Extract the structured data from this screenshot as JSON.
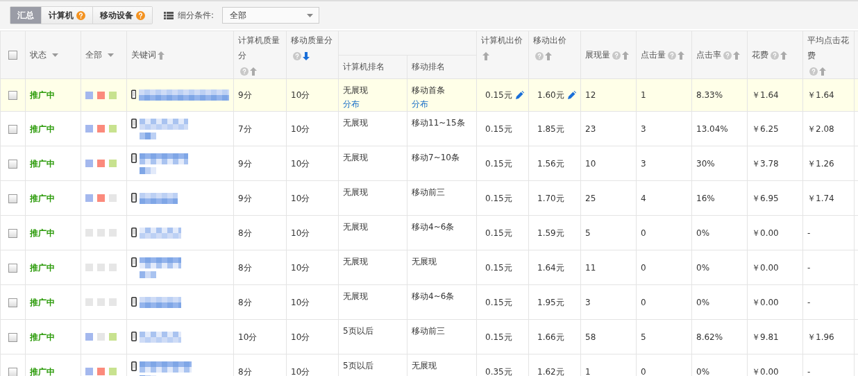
{
  "toolbar": {
    "tabs": [
      {
        "label": "汇总",
        "selected": true,
        "help": false
      },
      {
        "label": "计算机",
        "selected": false,
        "help": true
      },
      {
        "label": "移动设备",
        "selected": false,
        "help": true
      }
    ],
    "filter_label": "细分条件:",
    "filter_value": "全部"
  },
  "table": {
    "select_all": {
      "checked": false
    },
    "columns": [
      {
        "label": "状态",
        "dropdown": true,
        "help": false,
        "sortable": false
      },
      {
        "label": "全部",
        "dropdown": true,
        "help": false,
        "sortable": false
      },
      {
        "label": "关键词",
        "dropdown": false,
        "help": false,
        "sortable": true,
        "active_sort": false
      },
      {
        "label": "计算机质量分",
        "dropdown": false,
        "help": true,
        "sortable": true,
        "active_sort": false
      },
      {
        "label": "移动质量分",
        "dropdown": false,
        "help": true,
        "sortable": true,
        "active_sort": true
      },
      {
        "label": "计算机排名",
        "dropdown": false,
        "help": false,
        "sortable": false
      },
      {
        "label": "移动排名",
        "dropdown": false,
        "help": false,
        "sortable": false
      },
      {
        "label": "计算机出价",
        "dropdown": false,
        "help": false,
        "sortable": true,
        "active_sort": false
      },
      {
        "label": "移动出价",
        "dropdown": false,
        "help": true,
        "sortable": true,
        "active_sort": false
      },
      {
        "label": "展现量",
        "dropdown": false,
        "help": true,
        "sortable": true,
        "active_sort": false
      },
      {
        "label": "点击量",
        "dropdown": false,
        "help": true,
        "sortable": true,
        "active_sort": false
      },
      {
        "label": "点击率",
        "dropdown": false,
        "help": true,
        "sortable": true,
        "active_sort": false
      },
      {
        "label": "花费",
        "dropdown": false,
        "help": true,
        "sortable": true,
        "active_sort": false
      },
      {
        "label": "平均点击花费",
        "dropdown": false,
        "help": true,
        "sortable": true,
        "active_sort": false
      }
    ],
    "rows": [
      {
        "selected": true,
        "checked": false,
        "status": "推广中",
        "flags": [
          {
            "on": true,
            "color": "#a4b8ee"
          },
          {
            "on": true,
            "color": "#fb8a7c"
          },
          {
            "on": true,
            "color": "#c8e28f"
          }
        ],
        "pc_score": "9分",
        "mobile_score": "10分",
        "pc_rank": "无展现",
        "pc_rank_link": "分布",
        "mobile_rank": "移动首条",
        "mobile_rank_link": "分布",
        "pc_bid": "0.15元",
        "mobile_bid": "1.60元",
        "impressions": "12",
        "clicks": "1",
        "ctr": "8.33%",
        "cost": "￥1.64",
        "avg_cpc": "￥1.64"
      },
      {
        "selected": false,
        "checked": false,
        "status": "推广中",
        "flags": [
          {
            "on": true,
            "color": "#a4b8ee"
          },
          {
            "on": true,
            "color": "#fb8a7c"
          },
          {
            "on": true,
            "color": "#c8e28f"
          }
        ],
        "pc_score": "7分",
        "mobile_score": "10分",
        "pc_rank": "无展现",
        "mobile_rank": "移动11~15条",
        "pc_bid": "0.15元",
        "mobile_bid": "1.85元",
        "impressions": "23",
        "clicks": "3",
        "ctr": "13.04%",
        "cost": "￥6.25",
        "avg_cpc": "￥2.08"
      },
      {
        "selected": false,
        "checked": false,
        "status": "推广中",
        "flags": [
          {
            "on": true,
            "color": "#a4b8ee"
          },
          {
            "on": true,
            "color": "#fb8a7c"
          },
          {
            "on": true,
            "color": "#c8e28f"
          }
        ],
        "pc_score": "9分",
        "mobile_score": "10分",
        "pc_rank": "无展现",
        "mobile_rank": "移动7~10条",
        "pc_bid": "0.15元",
        "mobile_bid": "1.56元",
        "impressions": "10",
        "clicks": "3",
        "ctr": "30%",
        "cost": "￥3.78",
        "avg_cpc": "￥1.26"
      },
      {
        "selected": false,
        "checked": false,
        "status": "推广中",
        "flags": [
          {
            "on": true,
            "color": "#a4b8ee"
          },
          {
            "on": true,
            "color": "#fb8a7c"
          },
          {
            "on": false
          }
        ],
        "pc_score": "9分",
        "mobile_score": "10分",
        "pc_rank": "无展现",
        "mobile_rank": "移动前三",
        "pc_bid": "0.15元",
        "mobile_bid": "1.70元",
        "impressions": "25",
        "clicks": "4",
        "ctr": "16%",
        "cost": "￥6.95",
        "avg_cpc": "￥1.74"
      },
      {
        "selected": false,
        "checked": false,
        "status": "推广中",
        "flags": [
          {
            "on": false
          },
          {
            "on": false
          },
          {
            "on": false
          }
        ],
        "pc_score": "8分",
        "mobile_score": "10分",
        "pc_rank": "无展现",
        "mobile_rank": "移动4~6条",
        "pc_bid": "0.15元",
        "mobile_bid": "1.59元",
        "impressions": "5",
        "clicks": "0",
        "ctr": "0%",
        "cost": "￥0.00",
        "avg_cpc": "-"
      },
      {
        "selected": false,
        "checked": false,
        "status": "推广中",
        "flags": [
          {
            "on": false
          },
          {
            "on": false
          },
          {
            "on": false
          }
        ],
        "pc_score": "8分",
        "mobile_score": "10分",
        "pc_rank": "无展现",
        "mobile_rank": "无展现",
        "pc_bid": "0.15元",
        "mobile_bid": "1.64元",
        "impressions": "11",
        "clicks": "0",
        "ctr": "0%",
        "cost": "￥0.00",
        "avg_cpc": "-"
      },
      {
        "selected": false,
        "checked": false,
        "status": "推广中",
        "flags": [
          {
            "on": false
          },
          {
            "on": false
          },
          {
            "on": false
          }
        ],
        "pc_score": "8分",
        "mobile_score": "10分",
        "pc_rank": "无展现",
        "mobile_rank": "移动4~6条",
        "pc_bid": "0.15元",
        "mobile_bid": "1.95元",
        "impressions": "3",
        "clicks": "0",
        "ctr": "0%",
        "cost": "￥0.00",
        "avg_cpc": "-"
      },
      {
        "selected": false,
        "checked": false,
        "status": "推广中",
        "flags": [
          {
            "on": true,
            "color": "#a4b8ee"
          },
          {
            "on": false
          },
          {
            "on": true,
            "color": "#c8e28f"
          }
        ],
        "pc_score": "10分",
        "mobile_score": "10分",
        "pc_rank": "5页以后",
        "mobile_rank": "移动前三",
        "pc_bid": "0.15元",
        "mobile_bid": "1.66元",
        "impressions": "58",
        "clicks": "5",
        "ctr": "8.62%",
        "cost": "￥9.81",
        "avg_cpc": "￥1.96"
      },
      {
        "selected": false,
        "checked": false,
        "status": "推广中",
        "flags": [
          {
            "on": true,
            "color": "#a4b8ee"
          },
          {
            "on": true,
            "color": "#fb8a7c"
          },
          {
            "on": true,
            "color": "#c8e28f"
          }
        ],
        "pc_score": "8分",
        "mobile_score": "10分",
        "pc_rank": "5页以后",
        "mobile_rank": "无展现",
        "pc_bid": "0.35元",
        "mobile_bid": "1.62元",
        "impressions": "1",
        "clicks": "0",
        "ctr": "0%",
        "cost": "￥0.00",
        "avg_cpc": "-"
      }
    ]
  }
}
